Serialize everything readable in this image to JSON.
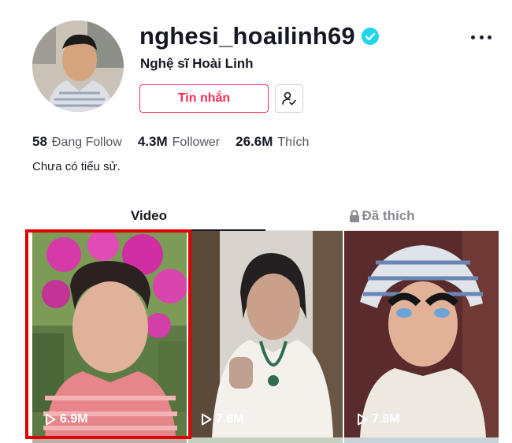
{
  "profile": {
    "username": "nghesi_hoailinh69",
    "nickname": "Nghệ sĩ Hoài Linh",
    "message_button": "Tin nhắn",
    "stats": {
      "following_count": "58",
      "following_label": "Đang Follow",
      "followers_count": "4.3M",
      "followers_label": "Follower",
      "likes_count": "26.6M",
      "likes_label": "Thích"
    },
    "bio": "Chưa có tiểu sử."
  },
  "tabs": {
    "videos": "Video",
    "liked": "Đã thích"
  },
  "videos": [
    {
      "views": "6.9M"
    },
    {
      "views": "7.8M"
    },
    {
      "views": "7.9M"
    }
  ],
  "colors": {
    "accent": "#fe2c55",
    "verified": "#20d5ec",
    "highlight": "#e00000"
  },
  "icons": {
    "verified": "verified-badge-icon",
    "more": "more-dots-icon",
    "follow_status": "user-check-icon",
    "lock": "lock-icon",
    "play": "play-icon"
  }
}
